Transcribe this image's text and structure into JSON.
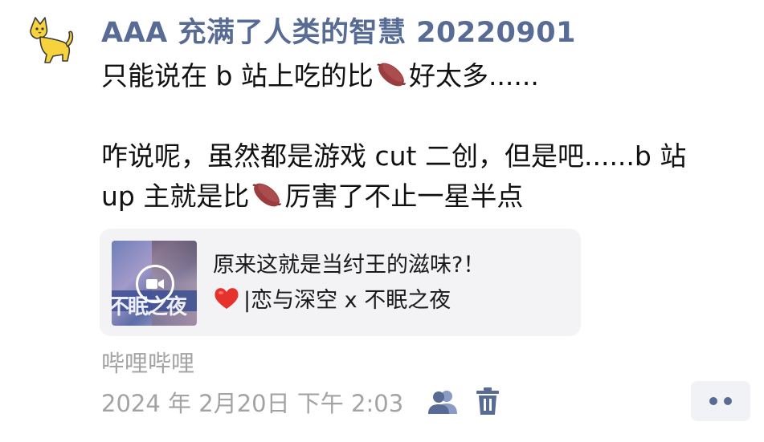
{
  "post": {
    "author": "AAA 充满了人类的智慧 20220901",
    "lines": [
      {
        "before": "只能说在 b 站上吃的比",
        "emoji": "sweet-potato-icon",
        "after": "好太多......"
      },
      {
        "text": "咋说呢，虽然都是游戏 cut 二创，但是吧......b 站"
      },
      {
        "before": "up 主就是比",
        "emoji": "sweet-potato-icon",
        "after": "厉害了不止一星半点"
      }
    ]
  },
  "link_card": {
    "title_line1": "原来这就是当纣王的滋味?！",
    "title_line2": "|恋与深空 x 不眠之夜",
    "thumbnail_text": "不眠之夜"
  },
  "source": "哔哩哔哩",
  "timestamp": "2024 年 2月20日 下午 2:03",
  "colors": {
    "author": "#576b95",
    "meta_gray": "#a3a3a3",
    "card_bg": "#f3f3f5"
  }
}
